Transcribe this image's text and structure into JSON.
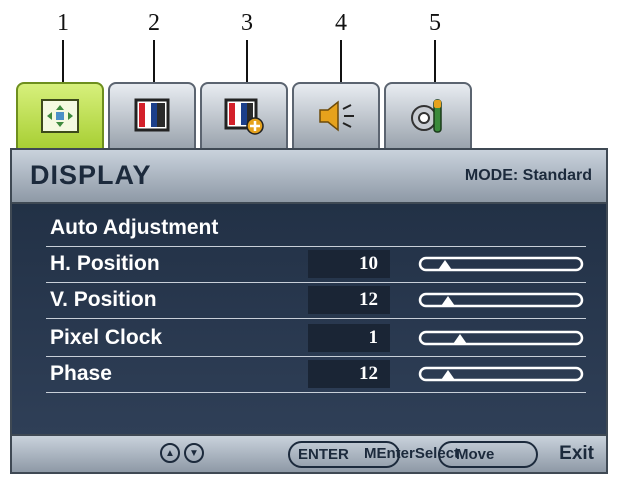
{
  "callouts": [
    "1",
    "2",
    "3",
    "4",
    "5"
  ],
  "tabs": [
    {
      "icon": "display-icon"
    },
    {
      "icon": "picture-icon"
    },
    {
      "icon": "picture-advanced-icon"
    },
    {
      "icon": "audio-icon"
    },
    {
      "icon": "system-icon"
    }
  ],
  "header": {
    "title": "DISPLAY",
    "mode": "MODE: Standard"
  },
  "rows": [
    {
      "label": "Auto Adjustment"
    },
    {
      "label": "H. Position",
      "value": "10",
      "level": 0.1
    },
    {
      "label": "V. Position",
      "value": "12",
      "level": 0.12
    },
    {
      "label": "Pixel Clock",
      "value": "1",
      "level": 0.2
    },
    {
      "label": "Phase",
      "value": "12",
      "level": 0.12
    }
  ],
  "footer": {
    "enter_label": "ENTER",
    "overlay_text_1": "MEnterSelect",
    "move_label": "Move",
    "exit_label": "Exit"
  },
  "colors": {
    "accent": "#a8cf34",
    "panel": "#223146",
    "bar": "#c9d2dc"
  }
}
